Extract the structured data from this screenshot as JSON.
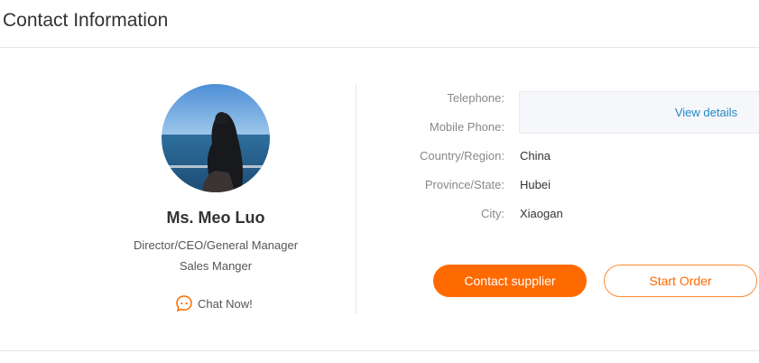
{
  "page": {
    "title": "Contact Information"
  },
  "profile": {
    "name": "Ms. Meo Luo",
    "roles": [
      "Director/CEO/General Manager",
      "Sales Manger"
    ],
    "chat_label": "Chat Now!"
  },
  "details": {
    "telephone_label": "Telephone:",
    "mobile_label": "Mobile Phone:",
    "view_details": "View details",
    "fields": [
      {
        "label": "Country/Region:",
        "value": "China"
      },
      {
        "label": "Province/State:",
        "value": "Hubei"
      },
      {
        "label": "City:",
        "value": "Xiaogan"
      }
    ]
  },
  "actions": {
    "contact_supplier": "Contact supplier",
    "start_order": "Start Order"
  },
  "colors": {
    "accent": "#ff6a00",
    "link": "#1e88c8"
  },
  "icons": {
    "chat": "chat-icon"
  }
}
